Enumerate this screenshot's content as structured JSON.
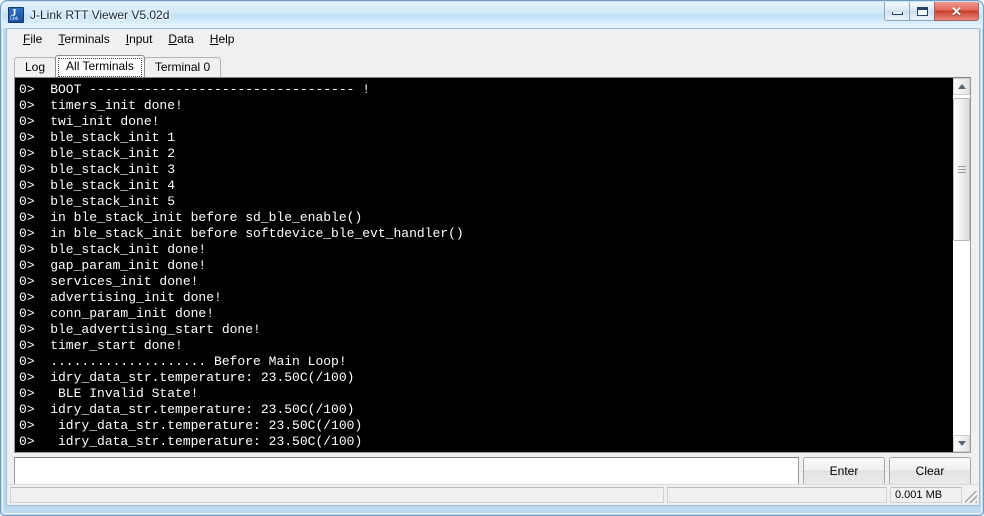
{
  "window": {
    "title": "J-Link RTT Viewer V5.02d",
    "icon": "jlink-app-icon",
    "controls": {
      "minimize": "minimize-icon",
      "maximize": "maximize-icon",
      "close": "✕"
    },
    "frame_accent": "#c3dff4",
    "close_accent": "#c93d2c"
  },
  "menu": [
    {
      "accel": "F",
      "rest": "ile"
    },
    {
      "accel": "T",
      "rest": "erminals"
    },
    {
      "accel": "I",
      "rest": "nput"
    },
    {
      "accel": "D",
      "rest": "ata"
    },
    {
      "accel": "H",
      "rest": "elp"
    }
  ],
  "tabs": [
    {
      "label": "Log",
      "selected": false
    },
    {
      "label": "All Terminals",
      "selected": true
    },
    {
      "label": "Terminal 0",
      "selected": false
    }
  ],
  "console": {
    "background": "#000000",
    "foreground": "#ffffff",
    "channel_prefix": "0>",
    "lines": [
      "0>  BOOT ---------------------------------- !",
      "0>  timers_init done!",
      "0>  twi_init done!",
      "0>  ble_stack_init 1",
      "0>  ble_stack_init 2",
      "0>  ble_stack_init 3",
      "0>  ble_stack_init 4",
      "0>  ble_stack_init 5",
      "0>  in ble_stack_init before sd_ble_enable()",
      "0>  in ble_stack_init before softdevice_ble_evt_handler()",
      "0>  ble_stack_init done!",
      "0>  gap_param_init done!",
      "0>  services_init done!",
      "0>  advertising_init done!",
      "0>  conn_param_init done!",
      "0>  ble_advertising_start done!",
      "0>  timer_start done!",
      "0>  .................... Before Main Loop!",
      "0>  idry_data_str.temperature: 23.50C(/100)",
      "0>   BLE Invalid State!",
      "0>  idry_data_str.temperature: 23.50C(/100)",
      "0>   idry_data_str.temperature: 23.50C(/100)",
      "0>   idry_data_str.temperature: 23.50C(/100)"
    ]
  },
  "scrollbar": {
    "up_arrow": "scroll-up-arrow-icon",
    "down_arrow": "scroll-down-arrow-icon",
    "thumb_grip": "scrollbar-grip-icon",
    "thumb_top_pct": 1,
    "thumb_height_pct": 42
  },
  "input": {
    "value": "",
    "placeholder": ""
  },
  "buttons": {
    "enter": "Enter",
    "clear": "Clear"
  },
  "status": {
    "main": "",
    "mid": "",
    "size": "0.001 MB",
    "grip": "resize-grip-icon"
  }
}
